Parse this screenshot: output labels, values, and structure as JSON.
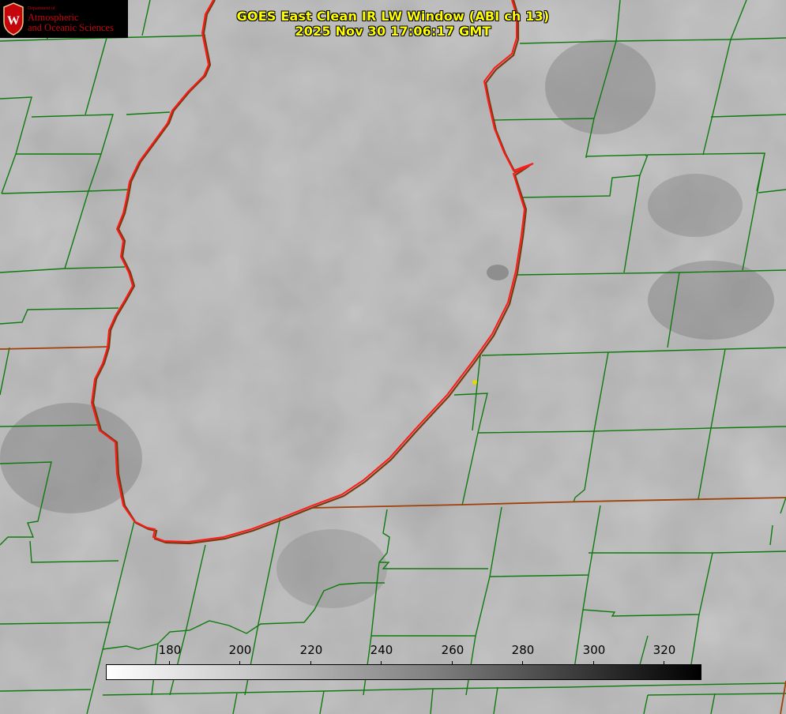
{
  "header": {
    "title": "GOES East Clean IR LW Window (ABI ch 13)",
    "timestamp": "2025 Nov 30 17:06:17 GMT"
  },
  "logo": {
    "org_small": "Department of",
    "org_line1": "Atmospheric",
    "org_line2": "and Oceanic Sciences",
    "emblem_letter": "W"
  },
  "colorbar": {
    "ticks": [
      "180",
      "200",
      "220",
      "240",
      "260",
      "280",
      "300",
      "320"
    ],
    "gradient": "white-to-black"
  },
  "colors": {
    "title": "#ffff00",
    "county_lines": "#0f7a0f",
    "lake_outline": "#ff1a1a",
    "state_line": "#a0400a",
    "marker": "#e6d800",
    "logo_red": "#c5050c",
    "background_gray": "#8a8a8a"
  },
  "map": {
    "feature": "Lake Michigan outline",
    "marker": "yellow-dot"
  }
}
